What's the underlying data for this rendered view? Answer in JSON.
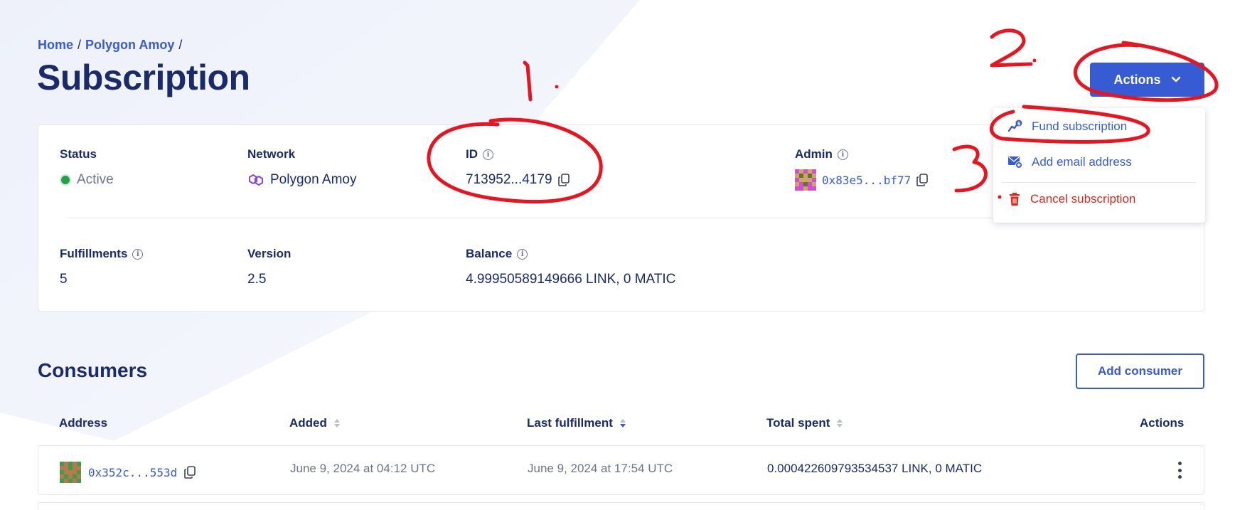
{
  "breadcrumb": {
    "home": "Home",
    "network": "Polygon Amoy"
  },
  "page": {
    "title": "Subscription"
  },
  "actions_button": {
    "label": "Actions"
  },
  "details": {
    "status": {
      "label": "Status",
      "value": "Active"
    },
    "network": {
      "label": "Network",
      "value": "Polygon Amoy"
    },
    "id": {
      "label": "ID",
      "value": "713952...4179"
    },
    "admin": {
      "label": "Admin",
      "value": "0x83e5...bf77"
    },
    "fulfillments": {
      "label": "Fulfillments",
      "value": "5"
    },
    "version": {
      "label": "Version",
      "value": "2.5"
    },
    "balance": {
      "label": "Balance",
      "value": "4.99950589149666 LINK, 0 MATIC"
    }
  },
  "actions_menu": {
    "items": [
      {
        "label": "Fund subscription",
        "icon": "fund-icon"
      },
      {
        "label": "Add email address",
        "icon": "email-add-icon"
      },
      {
        "label": "Cancel subscription",
        "icon": "trash-icon"
      }
    ]
  },
  "consumers": {
    "title": "Consumers",
    "add_button": "Add consumer",
    "columns": [
      "Address",
      "Added",
      "Last fulfillment",
      "Total spent",
      "Actions"
    ],
    "rows": [
      {
        "address": "0x352c...553d",
        "added": "June 9, 2024 at 04:12 UTC",
        "last_fulfillment": "June 9, 2024 at 17:54 UTC",
        "total_spent": "0.000422609793534537 LINK, 0 MATIC"
      }
    ]
  },
  "annotations": {
    "one": "1.",
    "two": "2.",
    "three": "3."
  },
  "colors": {
    "primary": "#375bd2",
    "navy": "#1a2b6b",
    "danger": "#d6281d",
    "success": "#24a148",
    "annotation": "#e8141f"
  }
}
